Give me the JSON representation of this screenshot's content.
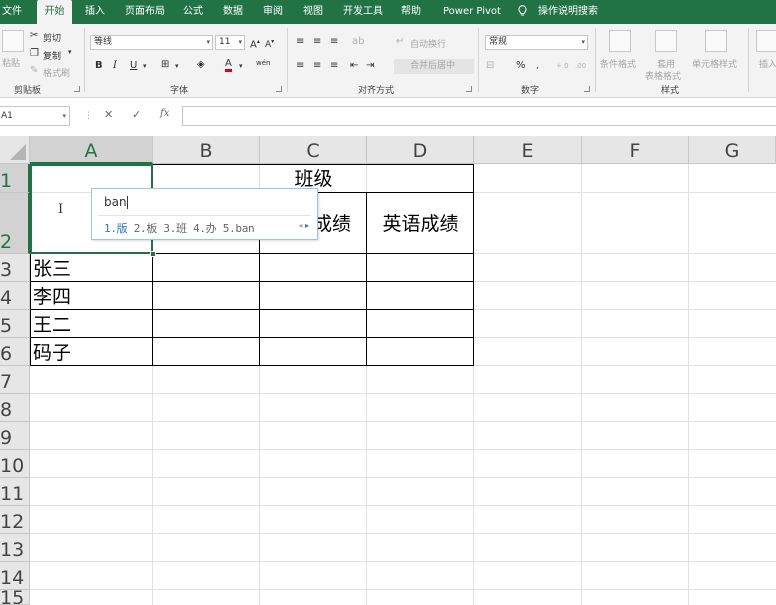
{
  "tabs": [
    {
      "id": "file",
      "label": "文件"
    },
    {
      "id": "home",
      "label": "开始",
      "active": true
    },
    {
      "id": "insert",
      "label": "插入"
    },
    {
      "id": "pagelayout",
      "label": "页面布局"
    },
    {
      "id": "formulas",
      "label": "公式"
    },
    {
      "id": "data",
      "label": "数据"
    },
    {
      "id": "review",
      "label": "审阅"
    },
    {
      "id": "view",
      "label": "视图"
    },
    {
      "id": "developer",
      "label": "开发工具"
    },
    {
      "id": "help",
      "label": "帮助"
    },
    {
      "id": "powerpivot",
      "label": "Power Pivot"
    }
  ],
  "tellme": "操作说明搜索",
  "ribbon": {
    "clipboard": {
      "paste": "粘贴",
      "cut": "剪切",
      "copy": "复制",
      "format_painter": "格式刷",
      "group": "剪贴板"
    },
    "font": {
      "name": "等线",
      "size": "11",
      "bold": "B",
      "italic": "I",
      "underline": "U",
      "wen": "wén",
      "group": "字体"
    },
    "alignment": {
      "wrap": "自动换行",
      "merge": "合并后居中",
      "group": "对齐方式"
    },
    "number": {
      "format": "常规",
      "percent": "%",
      "group": "数字"
    },
    "styles": {
      "conditional": "条件格式",
      "table1": "套用",
      "table2": "表格格式",
      "cellstyle": "单元格样式",
      "group": "样式"
    },
    "cells": {
      "insert": "插入"
    }
  },
  "formula_bar": {
    "name_box": "A1",
    "cancel": "✕",
    "enter": "✓",
    "fx": "fx",
    "value": ""
  },
  "columns": [
    "A",
    "B",
    "C",
    "D",
    "E",
    "F",
    "G"
  ],
  "rows": [
    "1",
    "2",
    "3",
    "4",
    "5",
    "6",
    "7",
    "8",
    "9",
    "10",
    "11",
    "12",
    "13",
    "14",
    "15"
  ],
  "cells": {
    "C1": "班级",
    "C2": "数学成绩",
    "D2": "英语成绩",
    "A3": "张三",
    "A4": "李四",
    "A5": "王二",
    "A6": "码子"
  },
  "ime": {
    "composition": "ban",
    "candidates": [
      "1.版",
      "2.板",
      "3.班",
      "4.办",
      "5.ban"
    ]
  },
  "colors": {
    "accent": "#217346",
    "ime_highlight": "#2b78d4"
  }
}
